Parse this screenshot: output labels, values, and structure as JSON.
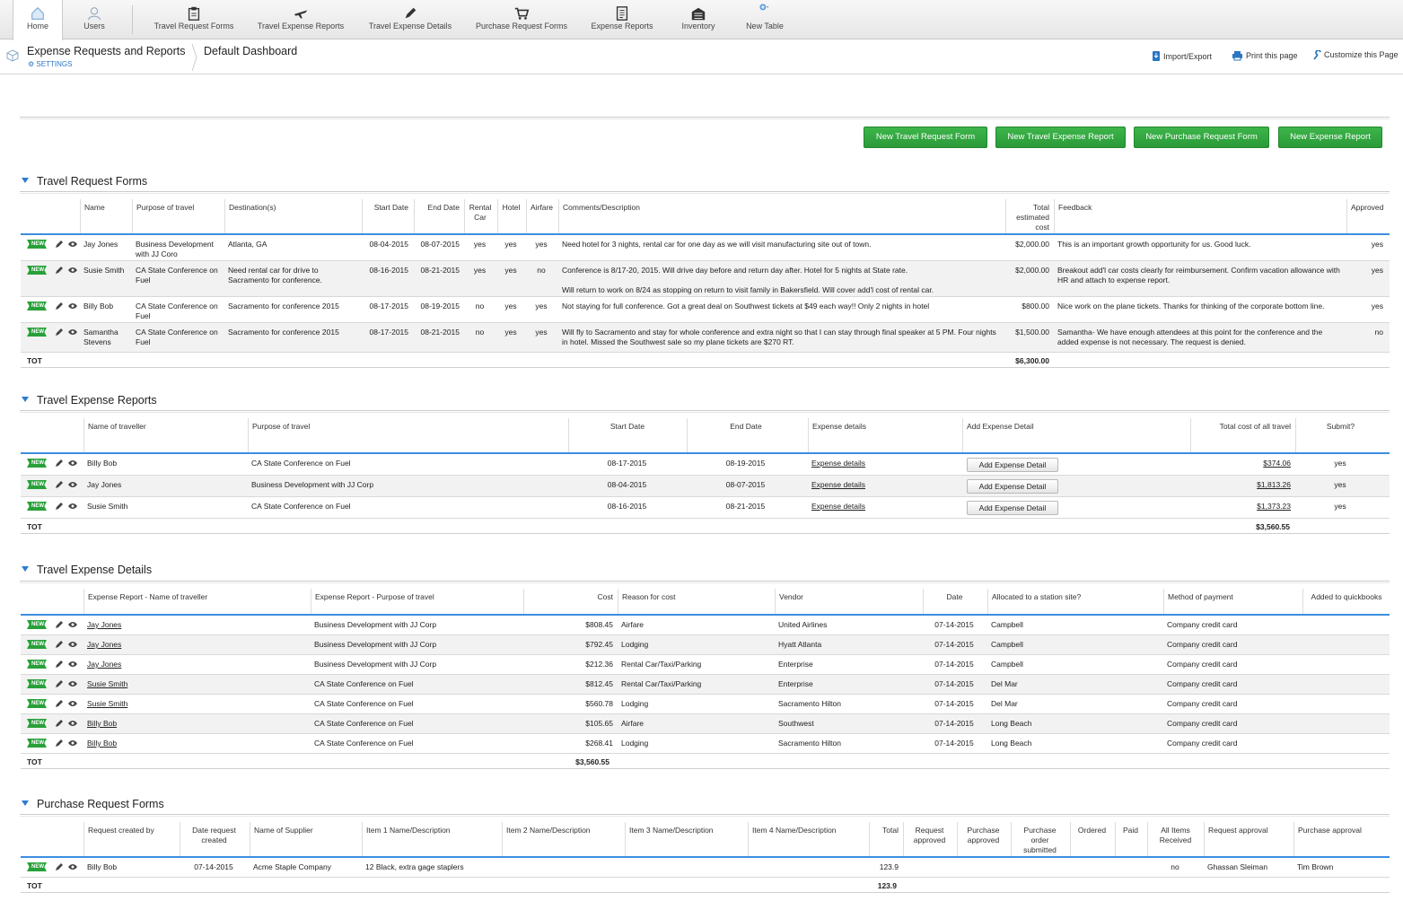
{
  "nav": [
    {
      "label": "Home",
      "icon": "home-icon"
    },
    {
      "label": "Users",
      "icon": "user-icon"
    },
    {
      "label": "Travel Request Forms",
      "icon": "clipboard-icon"
    },
    {
      "label": "Travel Expense Reports",
      "icon": "airplane-icon"
    },
    {
      "label": "Travel Expense Details",
      "icon": "pencil-icon"
    },
    {
      "label": "Purchase Request Forms",
      "icon": "cart-icon"
    },
    {
      "label": "Expense Reports",
      "icon": "document-icon"
    },
    {
      "label": "Inventory",
      "icon": "warehouse-icon"
    },
    {
      "label": "New Table",
      "icon": "plus-circle-icon"
    }
  ],
  "app": {
    "title": "Expense Requests and Reports",
    "settings": "SETTINGS",
    "dashboard": "Default Dashboard"
  },
  "tools": {
    "import": "Import/Export",
    "print": "Print this page",
    "customize": "Customize this Page"
  },
  "buttons": [
    "New Travel Request Form",
    "New Travel Expense Report",
    "New Purchase Request Form",
    "New Expense Report"
  ],
  "badge": "NEW",
  "tot_label": "TOT",
  "trf": {
    "title": "Travel Request Forms",
    "headers": [
      "Name",
      "Purpose of travel",
      "Destination(s)",
      "Start Date",
      "End Date",
      "Rental Car",
      "Hotel",
      "Airfare",
      "Comments/Description",
      "Total estimated cost",
      "Feedback",
      "Approved"
    ],
    "rows": [
      {
        "name": "Jay Jones",
        "purpose": "Business Development with JJ Coro",
        "dest": "Atlanta, GA",
        "start": "08-04-2015",
        "end": "08-07-2015",
        "car": "yes",
        "hotel": "yes",
        "air": "yes",
        "comments": "Need hotel for 3 nights, rental car for one day as we will visit manufacturing site out of town.",
        "cost": "$2,000.00",
        "feedback": "This is an important growth opportunity for us.  Good luck.",
        "approved": "yes"
      },
      {
        "name": "Susie Smith",
        "purpose": "CA State Conference on Fuel",
        "dest": "Need rental car for drive to Sacramento for conference.",
        "start": "08-16-2015",
        "end": "08-21-2015",
        "car": "yes",
        "hotel": "yes",
        "air": "no",
        "comments": "Conference is 8/17-20, 2015.  Will drive day before and return day after.  Hotel for 5 nights at State rate.",
        "comments2": "Will return to work on 8/24 as stopping on return to visit family in Bakersfield.  Will cover add'l cost of rental car.",
        "cost": "$2,000.00",
        "feedback": "Breakout add'l car costs clearly for reimbursement.  Confirm vacation allowance with HR and attach to expense report.",
        "approved": "yes"
      },
      {
        "name": "Billy Bob",
        "purpose": "CA State Conference on Fuel",
        "dest": "Sacramento for conference 2015",
        "start": "08-17-2015",
        "end": "08-19-2015",
        "car": "no",
        "hotel": "yes",
        "air": "yes",
        "comments": "Not staying for full conference.  Got a great deal on Southwest tickets at $49 each way!!  Only 2 nights in hotel",
        "cost": "$800.00",
        "feedback": "Nice work on the plane tickets.  Thanks for thinking of the corporate bottom line.",
        "approved": "yes"
      },
      {
        "name": "Samantha Stevens",
        "purpose": "CA State Conference on Fuel",
        "dest": "Sacramento for conference 2015",
        "start": "08-17-2015",
        "end": "08-21-2015",
        "car": "no",
        "hotel": "yes",
        "air": "yes",
        "comments": "Will fly to Sacramento and stay for whole conference and extra night so that I can stay through final speaker at 5 PM.  Four nights in hotel.  Missed the Southwest sale so my plane tickets are $270 RT.",
        "cost": "$1,500.00",
        "feedback": "Samantha- We have enough attendees at this point for the conference and the added expense is not necessary.  The request is denied.",
        "approved": "no"
      }
    ],
    "total": "$6,300.00"
  },
  "ter": {
    "title": "Travel Expense Reports",
    "headers": [
      "Name of traveller",
      "Purpose of travel",
      "Start Date",
      "End Date",
      "Expense details",
      "Add Expense Detail",
      "Total cost of all travel",
      "Submit?"
    ],
    "rows": [
      {
        "name": "Billy Bob",
        "purpose": "CA State Conference on Fuel",
        "start": "08-17-2015",
        "end": "08-19-2015",
        "details": "Expense details",
        "add": "Add  Expense Detail",
        "total": "$374.06",
        "submit": "yes"
      },
      {
        "name": "Jay Jones",
        "purpose": "Business Development with JJ Corp",
        "start": "08-04-2015",
        "end": "08-07-2015",
        "details": "Expense details",
        "add": "Add  Expense Detail",
        "total": "$1,813.26",
        "submit": "yes"
      },
      {
        "name": "Susie Smith",
        "purpose": "CA State Conference on Fuel",
        "start": "08-16-2015",
        "end": "08-21-2015",
        "details": "Expense details",
        "add": "Add  Expense Detail",
        "total": "$1,373.23",
        "submit": "yes"
      }
    ],
    "total": "$3,560.55"
  },
  "ted": {
    "title": "Travel Expense Details",
    "headers": [
      "Expense Report - Name of traveller",
      "Expense Report - Purpose of travel",
      "Cost",
      "Reason for cost",
      "Vendor",
      "Date",
      "Allocated to a station site?",
      "Method of payment",
      "Added to quickbooks"
    ],
    "rows": [
      {
        "name": "Jay Jones",
        "purpose": "Business Development with JJ Corp",
        "cost": "$808.45",
        "reason": "Airfare",
        "vendor": "United Airlines",
        "date": "07-14-2015",
        "site": "Campbell",
        "payment": "Company credit card"
      },
      {
        "name": "Jay Jones",
        "purpose": "Business Development with JJ Corp",
        "cost": "$792.45",
        "reason": "Lodging",
        "vendor": "Hyatt Atlanta",
        "date": "07-14-2015",
        "site": "Campbell",
        "payment": "Company credit card"
      },
      {
        "name": "Jay Jones",
        "purpose": "Business Development with JJ Corp",
        "cost": "$212.36",
        "reason": "Rental Car/Taxi/Parking",
        "vendor": "Enterprise",
        "date": "07-14-2015",
        "site": "Campbell",
        "payment": "Company credit card"
      },
      {
        "name": "Susie Smith",
        "purpose": "CA State Conference on Fuel",
        "cost": "$812.45",
        "reason": "Rental Car/Taxi/Parking",
        "vendor": "Enterprise",
        "date": "07-14-2015",
        "site": "Del Mar",
        "payment": "Company credit card"
      },
      {
        "name": "Susie Smith",
        "purpose": "CA State Conference on Fuel",
        "cost": "$560.78",
        "reason": "Lodging",
        "vendor": "Sacramento Hilton",
        "date": "07-14-2015",
        "site": "Del Mar",
        "payment": "Company credit card"
      },
      {
        "name": "Billy Bob",
        "purpose": "CA State Conference on Fuel",
        "cost": "$105.65",
        "reason": "Airfare",
        "vendor": "Southwest",
        "date": "07-14-2015",
        "site": "Long Beach",
        "payment": "Company credit card"
      },
      {
        "name": "Billy Bob",
        "purpose": "CA State Conference on Fuel",
        "cost": "$268.41",
        "reason": "Lodging",
        "vendor": "Sacramento Hilton",
        "date": "07-14-2015",
        "site": "Long Beach",
        "payment": "Company credit card"
      }
    ],
    "total": "$3,560.55"
  },
  "prf": {
    "title": "Purchase Request Forms",
    "headers": [
      "Request created by",
      "Date request created",
      "Name of Supplier",
      "Item 1 Name/Description",
      "Item 2 Name/Description",
      "Item 3 Name/Description",
      "Item 4 Name/Description",
      "Total",
      "Request approved",
      "Purchase approved",
      "Purchase order submitted",
      "Ordered",
      "Paid",
      "All Items Received",
      "Request approval",
      "Purchase approval"
    ],
    "rows": [
      {
        "by": "Billy Bob",
        "date": "07-14-2015",
        "supplier": "Acme Staple Company",
        "item1": "12 Black, extra gage staplers",
        "item2": "",
        "item3": "",
        "item4": "",
        "total": "123.9",
        "received": "no",
        "req_appr": "Ghassan Sleiman",
        "pur_appr": "Tim Brown"
      }
    ],
    "total": "123.9"
  },
  "colors": {
    "accent": "#3d8ee0",
    "green": "#2a9a38",
    "link": "#2a76c2"
  }
}
